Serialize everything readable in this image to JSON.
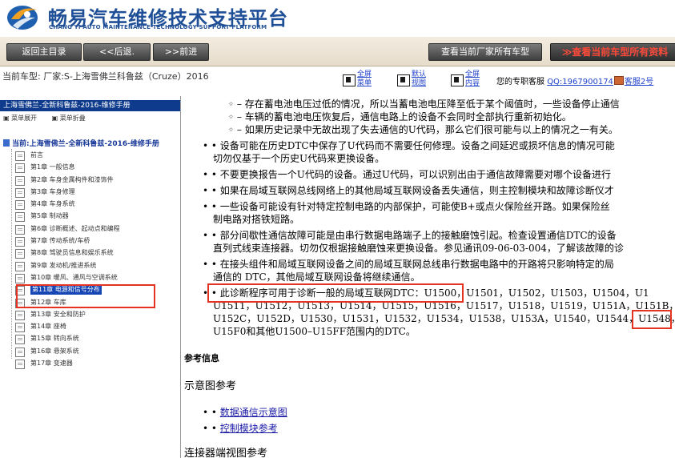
{
  "header": {
    "title": "畅易汽车维修技术支持平台",
    "subtitle": "CHANG YI AUTO MAINTENANCE TECHNOLOGY SUPPORT PLATFORM"
  },
  "toolbar": {
    "back_main": "返回主目录",
    "back": "<<后退.",
    "forward": ">>前进",
    "view_manufacturer": "查看当前厂家所有车型",
    "view_all": "≫查看当前车型所有资料"
  },
  "infobar": {
    "current_model": "当前车型:  厂家:S-上海雪佛兰科鲁兹（Cruze）2016",
    "btn_full_menu": [
      "全屏",
      "菜单"
    ],
    "btn_default_view": [
      "默认",
      "视图"
    ],
    "btn_full_content": [
      "全屏",
      "内容"
    ],
    "service_label": "您的专职客服",
    "qq": "QQ:1967900174",
    "service2": "客服2号"
  },
  "sidebar": {
    "manual_title": "上海雪佛兰-全新科鲁兹-2016-维修手册",
    "expand": "菜单展开",
    "collapse": "菜单折叠",
    "root": "当前:上海雪佛兰-全新科鲁兹-2016-维修手册",
    "items": [
      {
        "label": "前言"
      },
      {
        "label": "第1章 一般信息"
      },
      {
        "label": "第2章 车身金属构件和漆饰件"
      },
      {
        "label": "第3章 车身修理"
      },
      {
        "label": "第4章 车身系统"
      },
      {
        "label": "第5章 制动器"
      },
      {
        "label": "第6章 诊断概述、起动点和编程"
      },
      {
        "label": "第7章 传动系统/车桥"
      },
      {
        "label": "第8章 驾驶员信息和娱乐系统"
      },
      {
        "label": "第9章 发动机/推进系统"
      },
      {
        "label": "第10章 暖风、通风与空调系统"
      },
      {
        "label": "第11章 电源和信号分布"
      },
      {
        "label": "第12章 车库"
      },
      {
        "label": "第13章 安全和防护"
      },
      {
        "label": "第14章 座椅"
      },
      {
        "label": "第15章 转向系统"
      },
      {
        "label": "第16章 悬架系统"
      },
      {
        "label": "第17章 变速器"
      }
    ]
  },
  "content": {
    "lines": [
      "◦ – 存在蓄电池电压过低的情况，所以当蓄电池电压降至低于某个阈值时，一些设备停止通信",
      "◦ – 车辆的蓄电池电压恢复后，通信电路上的设备不会同时全部执行重新初始化。",
      "◦ – 如果历史记录中无故出现了失去通信的U代码，那么它们很可能与以上的情况之一有关。",
      "• • 设备可能在历史DTC中保存了U代码而不需要任何修理。设备之间延迟或损坏信息的情况可能",
      "切勿仅基于一个历史U代码来更换设备。",
      "• • 不要更换报告一个U代码的设备。通过U代码，可以识别出由于通信故障需要对哪个设备进行",
      "• • 如果在局域互联网总线网络上的其他局域互联网设备丢失通信，则主控制模块和故障诊断仪才",
      "• • 一些设备可能设有针对特定控制电路的内部保护，可能使B+或点火保险丝开路。如果保险丝",
      "制电路对搭铁短路。",
      "• • 部分间歇性通信故障可能是由串行数据电路端子上的接触磨蚀引起。检查设置通信DTC的设备",
      "直列式线束连接器。切勿仅根据接触磨蚀来更换设备。参见通讯09-06-03-004，了解该故障的诊",
      "• • 在接头组件和局域互联网设备之间的局域互联网总线串行数据电路中的开路将只影响特定的局",
      "通信的 DTC，其他局域互联网设备将继续通信。",
      "• • 此诊断程序可用于诊断一般的局域互联网DTC：U1500，U1501，U1502，U1503，U1504，U1",
      "U1511，U1512，U1513，U1514，U1515，U1516，U1517，U1518，U1519，U151A，U151B，U",
      "U152C，U152D，U1530，U1531，U1532，U1534，U1538，U153A，U1540，U1544，U1548，",
      "U15F0和其他U1500–U15FF范围内的DTC。"
    ],
    "ref_heading": "参考信息",
    "diagram_ref": "示意图参考",
    "links": [
      "数据通信示意图",
      "控制模块参考"
    ],
    "connector_ref": "连接器端视图参考"
  },
  "colors": {
    "brand": "#1f4f96",
    "highlight": "#e53323",
    "selected": "#1646b4"
  }
}
